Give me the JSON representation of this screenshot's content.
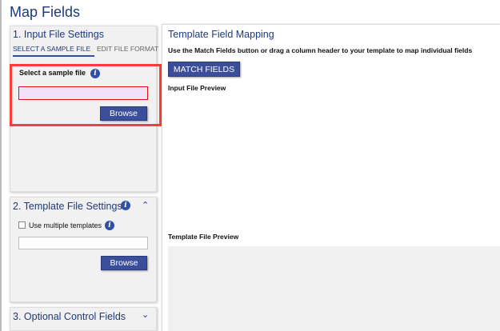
{
  "page": {
    "title": "Map Fields"
  },
  "input_settings": {
    "title": "1. Input File Settings",
    "tabs": [
      {
        "label": "SELECT A SAMPLE FILE",
        "active": true
      },
      {
        "label": "EDIT FILE FORMAT",
        "active": false
      }
    ],
    "select_label": "Select a sample file",
    "file_value": "",
    "browse_label": "Browse",
    "highlight_color": "#ff3b3b",
    "input_fill": "#f3e1f9"
  },
  "template_settings": {
    "title": "2. Template File Settings",
    "checkbox_label": "Use multiple templates",
    "checked": false,
    "file_value": "",
    "browse_label": "Browse",
    "chevron": "chevron-up-icon"
  },
  "optional": {
    "title": "3. Optional Control Fields",
    "chevron": "chevron-down-icon"
  },
  "mapping": {
    "title": "Template Field Mapping",
    "instruction": "Use the Match Fields button or drag a column header to your template to map individual fields",
    "match_label": "MATCH FIELDS",
    "input_preview": "Input File Preview",
    "template_preview": "Template File Preview"
  },
  "colors": {
    "accent": "#3a4e9c",
    "title": "#1e3a78"
  }
}
